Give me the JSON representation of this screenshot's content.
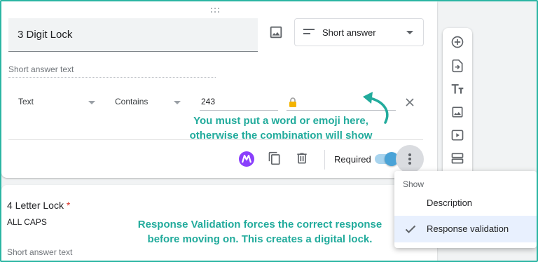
{
  "question1": {
    "title": "3 Digit Lock",
    "type_label": "Short answer",
    "answer_placeholder": "Short answer text",
    "validation": {
      "type": "Text",
      "condition": "Contains",
      "value": "243"
    },
    "required_label": "Required",
    "required_on": true
  },
  "annotations": {
    "note_top_line1": "You must put a word or emoji here,",
    "note_top_line2": "otherwise the combination will show",
    "note_bottom_line1": "Response Validation forces the correct response",
    "note_bottom_line2": "before moving on. This creates a digital lock."
  },
  "question2": {
    "title": "4 Letter Lock",
    "required_marker": "*",
    "description": "ALL CAPS",
    "answer_placeholder": "Short answer text"
  },
  "menu": {
    "header": "Show",
    "items": [
      {
        "label": "Description",
        "checked": false
      },
      {
        "label": "Response validation",
        "checked": true
      }
    ]
  },
  "sidebar": {
    "icons": [
      "add-question-icon",
      "import-questions-icon",
      "add-title-icon",
      "add-image-icon",
      "add-video-icon",
      "add-section-icon"
    ]
  },
  "colors": {
    "annotation": "#22ab9c",
    "frame": "#2bb5a3",
    "toggle": "#4aa3d7",
    "app_icon": "#8a3ffc",
    "required_star": "#d93025"
  }
}
